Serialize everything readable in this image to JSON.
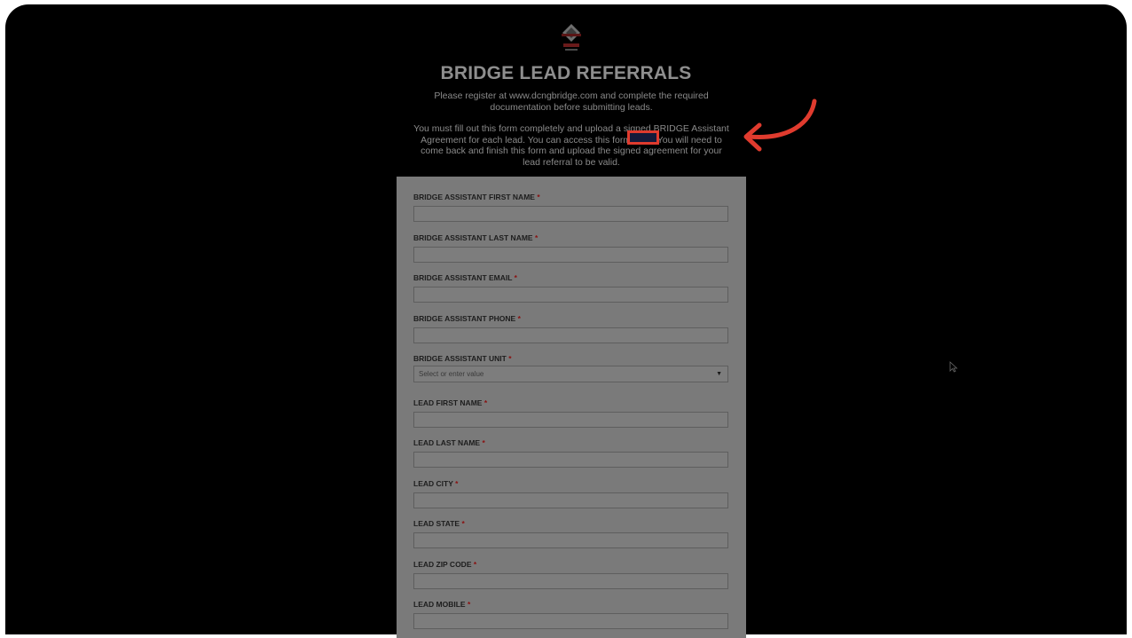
{
  "page": {
    "title": "BRIDGE LEAD REFERRALS",
    "intro": "Please register at www.dcngbridge.com and complete the required documentation before submitting leads.",
    "instructions": "You must fill out this form completely and upload a signed BRIDGE Assistant Agreement for each lead. You can access this form here. You will need to come back and finish this form and upload the signed agreement for your lead referral to be valid."
  },
  "form": {
    "required_marker": "*",
    "fields": [
      {
        "label": "BRIDGE ASSISTANT FIRST NAME",
        "type": "text",
        "value": ""
      },
      {
        "label": "BRIDGE ASSISTANT LAST NAME",
        "type": "text",
        "value": ""
      },
      {
        "label": "BRIDGE ASSISTANT EMAIL",
        "type": "text",
        "value": ""
      },
      {
        "label": "BRIDGE ASSISTANT PHONE",
        "type": "text",
        "value": ""
      },
      {
        "label": "BRIDGE ASSISTANT UNIT",
        "type": "select",
        "placeholder": "Select or enter value"
      },
      {
        "label": "LEAD FIRST NAME",
        "type": "text",
        "value": ""
      },
      {
        "label": "LEAD LAST NAME",
        "type": "text",
        "value": ""
      },
      {
        "label": "LEAD CITY",
        "type": "text",
        "value": ""
      },
      {
        "label": "LEAD STATE",
        "type": "text",
        "value": ""
      },
      {
        "label": "LEAD ZIP CODE",
        "type": "text",
        "value": ""
      },
      {
        "label": "LEAD MOBILE",
        "type": "text",
        "value": ""
      }
    ]
  },
  "icons": {
    "logo": "bridge-logo-icon",
    "annotation": "curved-arrow-icon",
    "cursor": "mouse-cursor-icon",
    "select_caret": "caret-down-icon"
  },
  "colors": {
    "backdrop": "#000000",
    "annotation": "#e03b2e",
    "form_panel": "#7a7a7a"
  }
}
